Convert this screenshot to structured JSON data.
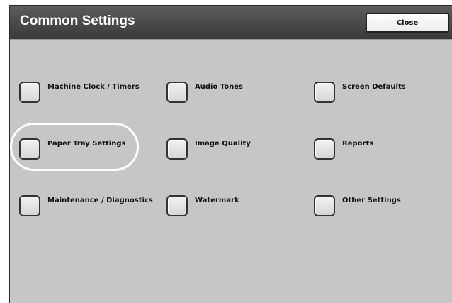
{
  "header": {
    "title": "Common Settings",
    "close_label": "Close"
  },
  "items": [
    {
      "label": "Machine Clock / Timers"
    },
    {
      "label": "Audio Tones"
    },
    {
      "label": "Screen Defaults"
    },
    {
      "label": "Paper Tray Settings"
    },
    {
      "label": "Image Quality"
    },
    {
      "label": "Reports"
    },
    {
      "label": "Maintenance / Diagnostics"
    },
    {
      "label": "Watermark"
    },
    {
      "label": "Other Settings"
    }
  ]
}
